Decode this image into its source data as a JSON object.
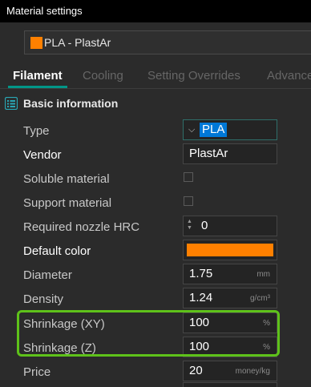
{
  "window": {
    "title": "Material settings"
  },
  "preset": {
    "name": "PLA - PlastAr",
    "color": "#ff8000"
  },
  "tabs": [
    {
      "label": "Filament",
      "active": true
    },
    {
      "label": "Cooling",
      "active": false
    },
    {
      "label": "Setting Overrides",
      "active": false
    },
    {
      "label": "Advanced",
      "active": false
    }
  ],
  "section": {
    "title": "Basic information",
    "icon": "list-icon"
  },
  "fields": {
    "type": {
      "label": "Type",
      "value": "PLA"
    },
    "vendor": {
      "label": "Vendor",
      "value": "PlastAr"
    },
    "soluble": {
      "label": "Soluble material",
      "checked": false
    },
    "support": {
      "label": "Support material",
      "checked": false
    },
    "nozzle_hrc": {
      "label": "Required nozzle HRC",
      "value": "0"
    },
    "default_color": {
      "label": "Default color",
      "value": "#ff8000"
    },
    "diameter": {
      "label": "Diameter",
      "value": "1.75",
      "unit": "mm"
    },
    "density": {
      "label": "Density",
      "value": "1.24",
      "unit": "g/cm³"
    },
    "shrinkage_xy": {
      "label": "Shrinkage (XY)",
      "value": "100",
      "unit": "%"
    },
    "shrinkage_z": {
      "label": "Shrinkage (Z)",
      "value": "100",
      "unit": "%"
    },
    "price": {
      "label": "Price",
      "value": "20",
      "unit": "money/kg"
    }
  },
  "colors": {
    "accent": "#009688",
    "highlight": "#5ec21a",
    "selection": "#0078d7"
  }
}
